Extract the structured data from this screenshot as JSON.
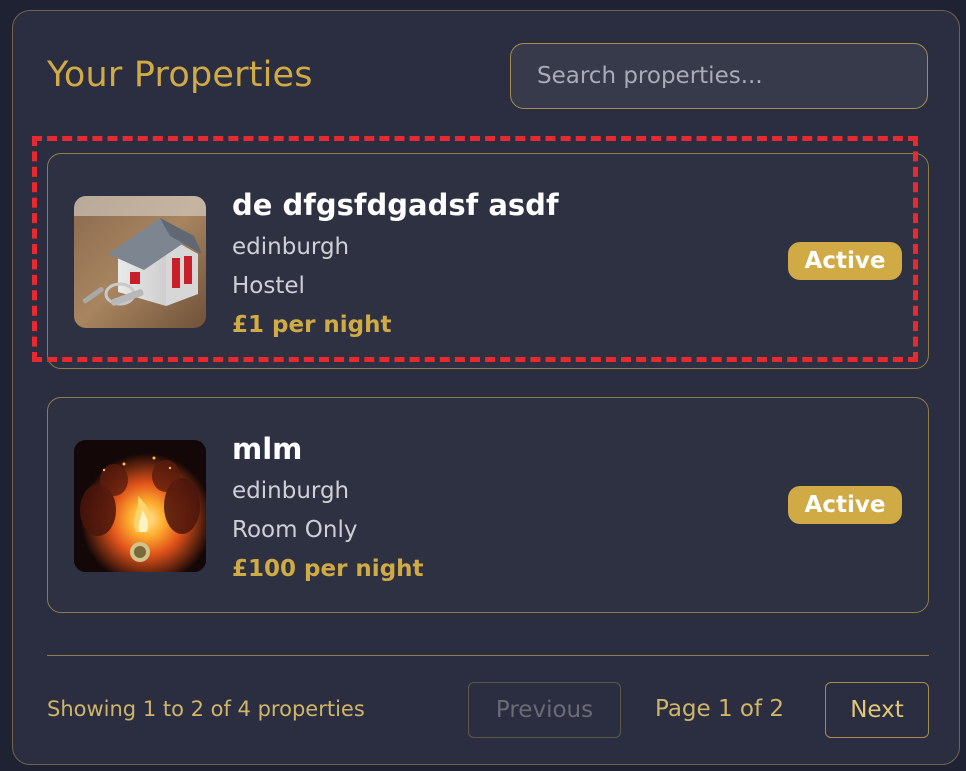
{
  "header": {
    "title": "Your Properties",
    "search_placeholder": "Search properties..."
  },
  "properties": [
    {
      "name": "de dfgsfdgadsf asdf",
      "city": "edinburgh",
      "type": "Hostel",
      "price": "£1 per night",
      "status": "Active",
      "image_icon": "house-key-photo"
    },
    {
      "name": "mlm",
      "city": "edinburgh",
      "type": "Room Only",
      "price": "£100 per night",
      "status": "Active",
      "image_icon": "campfire-photo"
    }
  ],
  "pagination": {
    "summary": "Showing 1 to 2 of 4 properties",
    "prev_label": "Previous",
    "page_label": "Page 1 of 2",
    "next_label": "Next",
    "prev_disabled": true
  },
  "colors": {
    "background": "#1f2233",
    "panel": "#2a2e40",
    "accent": "#d0aa45",
    "highlight": "#e8292f"
  }
}
